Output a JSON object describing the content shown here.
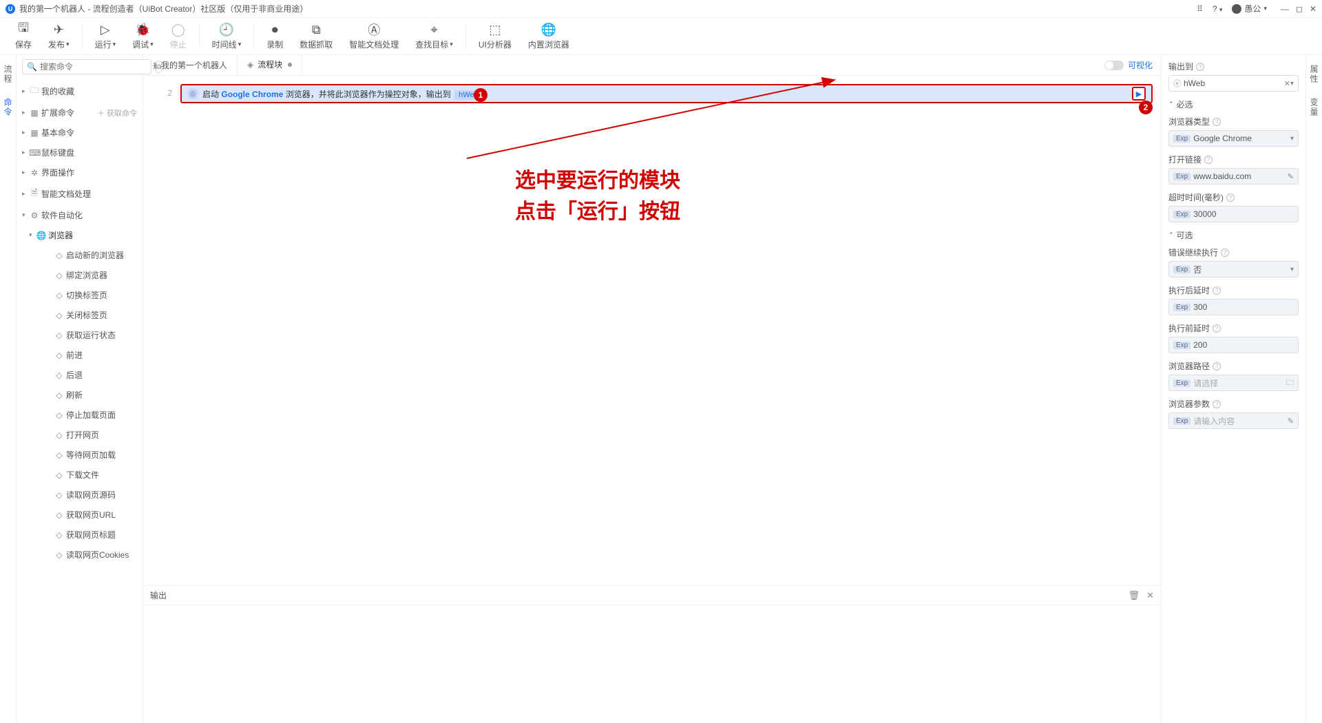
{
  "titlebar": {
    "title": "我的第一个机器人 - 流程创造者（UiBot Creator）社区版（仅用于非商业用途）",
    "user_name": "愚公"
  },
  "toolbar": {
    "save": "保存",
    "publish": "发布",
    "run": "运行",
    "debug": "调试",
    "stop": "停止",
    "timeaxis": "时间线",
    "record": "录制",
    "datacapture": "数据抓取",
    "smartdoc": "智能文档处理",
    "findtarget": "查找目标",
    "uianalyzer": "UI分析器",
    "builtin_browser": "内置浏览器"
  },
  "rail": {
    "flow": "流程",
    "cmd": "命令"
  },
  "rail_right": {
    "attr": "属性",
    "var": "变量"
  },
  "sidebar": {
    "search_placeholder": "搜索命令",
    "fetch_cmd": "获取命令",
    "items": [
      {
        "label": "我的收藏",
        "icon": "folder",
        "depth": 1,
        "caret": "▸"
      },
      {
        "label": "扩展命令",
        "icon": "grid",
        "depth": 1,
        "caret": "▸",
        "extra": "＋ 获取命令"
      },
      {
        "label": "基本命令",
        "icon": "grid",
        "depth": 1,
        "caret": "▸"
      },
      {
        "label": "鼠标键盘",
        "icon": "keyboard",
        "depth": 1,
        "caret": "▸"
      },
      {
        "label": "界面操作",
        "icon": "window",
        "depth": 1,
        "caret": "▸"
      },
      {
        "label": "智能文档处理",
        "icon": "doc",
        "depth": 1,
        "caret": "▸"
      },
      {
        "label": "软件自动化",
        "icon": "gear",
        "depth": 1,
        "caret": "▾"
      },
      {
        "label": "浏览器",
        "icon": "globe",
        "depth": 2,
        "caret": "▾",
        "exp": true,
        "blue": true
      },
      {
        "label": "启动新的浏览器",
        "icon": "◇",
        "depth": 3
      },
      {
        "label": "绑定浏览器",
        "icon": "◇",
        "depth": 3
      },
      {
        "label": "切换标签页",
        "icon": "◇",
        "depth": 3
      },
      {
        "label": "关闭标签页",
        "icon": "◇",
        "depth": 3
      },
      {
        "label": "获取运行状态",
        "icon": "◇",
        "depth": 3
      },
      {
        "label": "前进",
        "icon": "◇",
        "depth": 3
      },
      {
        "label": "后退",
        "icon": "◇",
        "depth": 3
      },
      {
        "label": "刷新",
        "icon": "◇",
        "depth": 3
      },
      {
        "label": "停止加载页面",
        "icon": "◇",
        "depth": 3
      },
      {
        "label": "打开网页",
        "icon": "◇",
        "depth": 3
      },
      {
        "label": "等待网页加载",
        "icon": "◇",
        "depth": 3
      },
      {
        "label": "下载文件",
        "icon": "◇",
        "depth": 3
      },
      {
        "label": "读取网页源码",
        "icon": "◇",
        "depth": 3
      },
      {
        "label": "获取网页URL",
        "icon": "◇",
        "depth": 3
      },
      {
        "label": "获取网页标题",
        "icon": "◇",
        "depth": 3
      },
      {
        "label": "读取网页Cookies",
        "icon": "◇",
        "depth": 3
      }
    ]
  },
  "tabs": {
    "tab1": "我的第一个机器人",
    "tab2": "流程块",
    "vis_label": "可视化"
  },
  "editor": {
    "line_no": "2",
    "line_prefix": "启动",
    "line_highlight": "Google Chrome",
    "line_mid": " 浏览器，并将此浏览器作为操控对象，输出到",
    "line_tag": "hWeb"
  },
  "callout": {
    "num1": "1",
    "num2": "2",
    "line1": "选中要运行的模块",
    "line2": "点击「运行」按钮"
  },
  "output": {
    "title": "输出"
  },
  "props": {
    "output_to": "输出到",
    "output_val": "hWeb",
    "sec_required": "必选",
    "browser_type": "浏览器类型",
    "browser_type_val": "Google Chrome",
    "open_link": "打开链接",
    "open_link_val": "www.baidu.com",
    "timeout": "超时时间(毫秒)",
    "timeout_val": "30000",
    "sec_optional": "可选",
    "continue_on_err": "错误继续执行",
    "continue_on_err_val": "否",
    "delay_after": "执行后延时",
    "delay_after_val": "300",
    "delay_before": "执行前延时",
    "delay_before_val": "200",
    "browser_path": "浏览器路径",
    "browser_path_ph": "请选择",
    "browser_args": "浏览器参数",
    "browser_args_ph": "请输入内容",
    "exp_badge": "Exp"
  }
}
